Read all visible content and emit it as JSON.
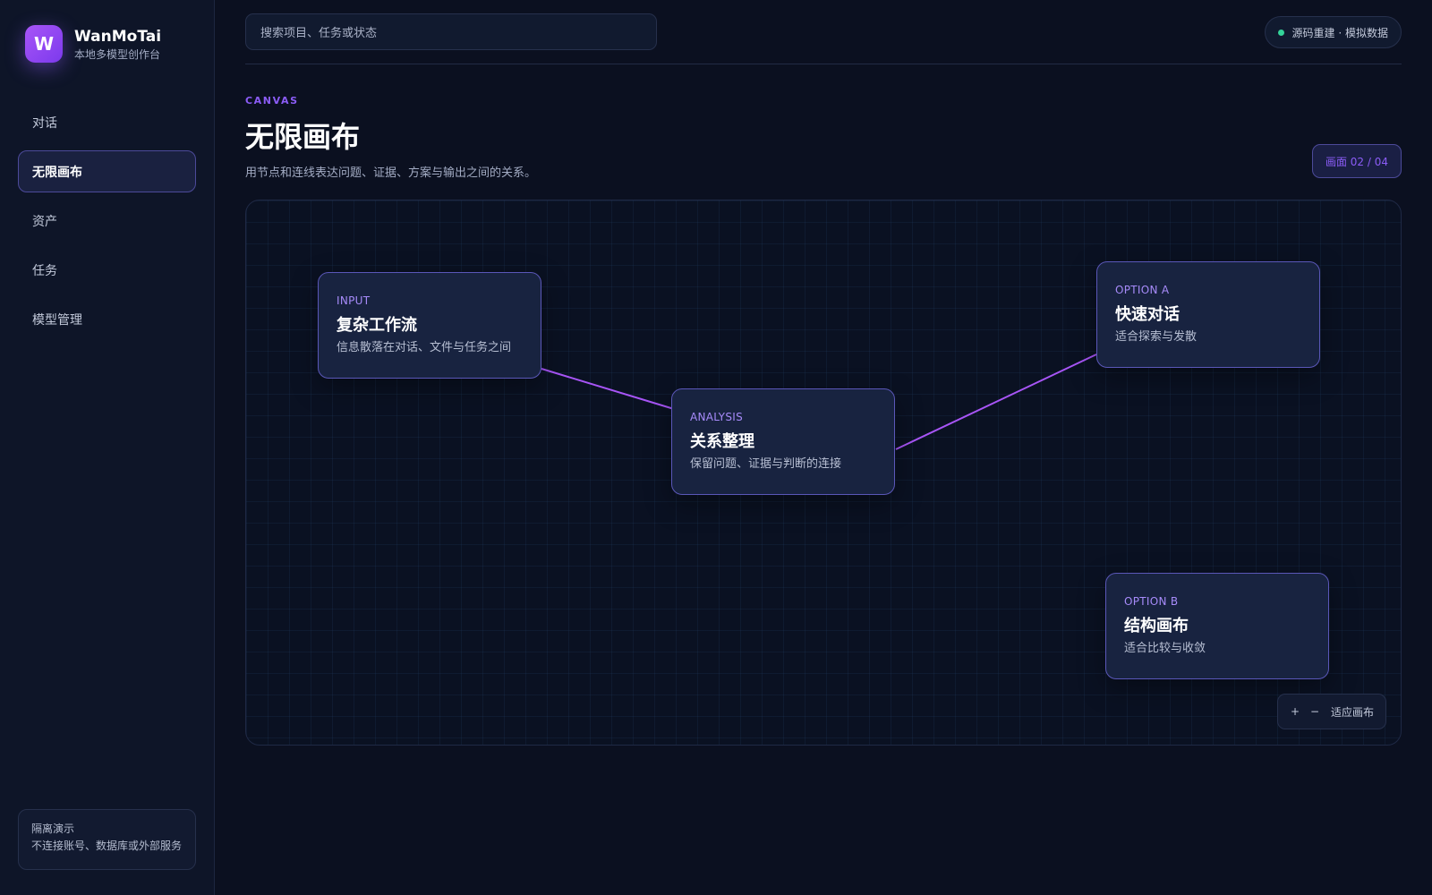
{
  "brand": {
    "logo_letter": "W",
    "name": "WanMoTai",
    "subtitle": "本地多模型创作台"
  },
  "nav": {
    "items": [
      {
        "label": "对话",
        "active": false
      },
      {
        "label": "无限画布",
        "active": true
      },
      {
        "label": "资产",
        "active": false
      },
      {
        "label": "任务",
        "active": false
      },
      {
        "label": "模型管理",
        "active": false
      }
    ]
  },
  "sidebar_note": {
    "title": "隔离演示",
    "text": "不连接账号、数据库或外部服务"
  },
  "search": {
    "placeholder": "搜索项目、任务或状态"
  },
  "status": {
    "text": "源码重建 · 模拟数据",
    "color": "#34d399"
  },
  "header": {
    "eyebrow": "CANVAS",
    "title": "无限画布",
    "description": "用节点和连线表达问题、证据、方案与输出之间的关系。",
    "page_counter": "画面 02 / 04"
  },
  "canvas": {
    "nodes": [
      {
        "tag": "INPUT",
        "title": "复杂工作流",
        "desc": "信息散落在对话、文件与任务之间"
      },
      {
        "tag": "ANALYSIS",
        "title": "关系整理",
        "desc": "保留问题、证据与判断的连接"
      },
      {
        "tag": "OPTION A",
        "title": "快速对话",
        "desc": "适合探索与发散"
      },
      {
        "tag": "OPTION B",
        "title": "结构画布",
        "desc": "适合比较与收敛"
      }
    ],
    "zoom": {
      "in": "+",
      "out": "−",
      "fit": "适应画布"
    }
  },
  "colors": {
    "accent": "#8b5cf6",
    "edge": "#a855f7",
    "background": "#0b1020"
  }
}
